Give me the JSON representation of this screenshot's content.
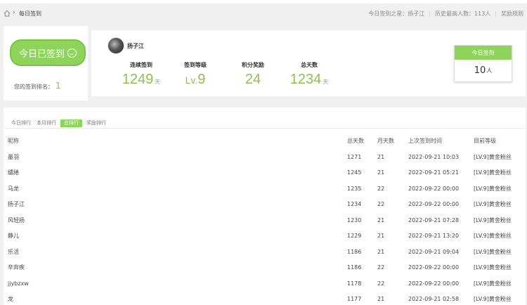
{
  "breadcrumb": {
    "icon": "home-icon",
    "title": "每日签到",
    "first_signer_label": "今日签到之星：扬子江",
    "record_label": "历史最高人数：113人",
    "rules_label": "奖励规则"
  },
  "sign": {
    "button_label": "今日已签到",
    "rank_label": "您的签到排名：",
    "rank_value": "1"
  },
  "user": {
    "name": "扬子江",
    "stats": [
      {
        "label": "连续签到",
        "value": "1249",
        "unit": "天"
      },
      {
        "label": "签到等级",
        "value": "Lv.",
        "level": "9",
        "unit": ""
      },
      {
        "label": "积分奖励",
        "value": "24",
        "unit": ""
      },
      {
        "label": "总天数",
        "value": "1234",
        "unit": "天"
      }
    ]
  },
  "today_card": {
    "title": "今日签到",
    "count": "10",
    "unit": "人"
  },
  "tabs": [
    "今日排行",
    "本月排行",
    "总排行",
    "奖励排行"
  ],
  "active_tab": "总排行",
  "table": {
    "headers": [
      "昵称",
      "总天数",
      "月天数",
      "上次签到时间",
      "目前等级"
    ],
    "rows": [
      [
        "墨羽",
        "1271",
        "21",
        "2022-09-21 10:03",
        "[LV.9]黄金粉丝"
      ],
      [
        "缱绻",
        "1245",
        "21",
        "2022-09-21 05:21",
        "[LV.9]黄金粉丝"
      ],
      [
        "马龙",
        "1235",
        "22",
        "2022-09-22 00:00",
        "[LV.9]黄金粉丝"
      ],
      [
        "扬子江",
        "1234",
        "22",
        "2022-09-22 00:00",
        "[LV.9]黄金粉丝"
      ],
      [
        "风轻扬",
        "1230",
        "21",
        "2022-09-21 07:28",
        "[LV.9]黄金粉丝"
      ],
      [
        "静儿",
        "1229",
        "21",
        "2022-09-21 13:20",
        "[LV.9]黄金粉丝"
      ],
      [
        "乐活",
        "1186",
        "21",
        "2022-09-21 09:04",
        "[LV.9]黄金粉丝"
      ],
      [
        "辛弃疾",
        "1186",
        "22",
        "2022-09-22 00:00",
        "[LV.9]黄金粉丝"
      ],
      [
        "jjybzxw",
        "1178",
        "22",
        "2022-09-22 00:00",
        "[LV.9]黄金粉丝"
      ],
      [
        "龙",
        "1177",
        "21",
        "2022-09-21 02:58",
        "[LV.9]黄金粉丝"
      ]
    ]
  },
  "colors": {
    "accent": "#8ed35a",
    "accent_text": "#8bc34a"
  }
}
